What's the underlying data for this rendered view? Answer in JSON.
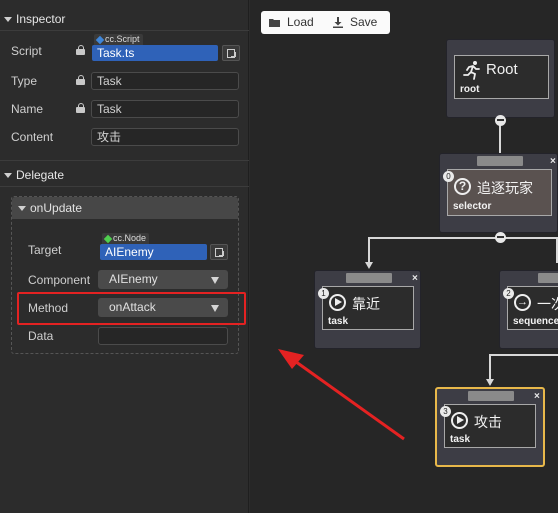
{
  "inspector": {
    "title": "Inspector",
    "script": {
      "label": "Script",
      "tag": "cc.Script",
      "value": "Task.ts"
    },
    "type": {
      "label": "Type",
      "value": "Task"
    },
    "name": {
      "label": "Name",
      "value": "Task"
    },
    "content": {
      "label": "Content",
      "value": "攻击"
    }
  },
  "delegate": {
    "title": "Delegate",
    "group_title": "onUpdate",
    "target": {
      "label": "Target",
      "tag": "cc.Node",
      "value": "AIEnemy"
    },
    "component": {
      "label": "Component",
      "value": "AIEnemy"
    },
    "method": {
      "label": "Method",
      "value": "onAttack"
    },
    "data": {
      "label": "Data",
      "value": ""
    }
  },
  "toolbar": {
    "load_label": "Load",
    "save_label": "Save"
  },
  "nodes": {
    "root": {
      "title": "Root",
      "sub": "root"
    },
    "selector": {
      "index": "0",
      "title": "追逐玩家",
      "sub": "selector"
    },
    "task1": {
      "index": "1",
      "title": "靠近",
      "sub": "task"
    },
    "sequence": {
      "index": "2",
      "title": "一次",
      "sub": "sequence"
    },
    "task3": {
      "index": "3",
      "title": "攻击",
      "sub": "task"
    },
    "close_glyph": "×"
  },
  "colors": {
    "highlight": "#e42222",
    "arrow": "#e42222",
    "selected_border": "#e8b84a",
    "ref_value": "#2f62b8"
  }
}
